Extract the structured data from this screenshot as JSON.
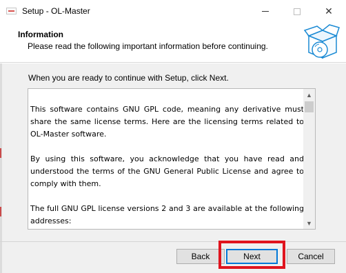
{
  "window": {
    "title": "Setup - OL-Master",
    "controls": {
      "minimize": "",
      "maximize": "",
      "close": "✕"
    }
  },
  "header": {
    "title": "Information",
    "subtitle": "Please read the following important information before continuing."
  },
  "instruction": "When you are ready to continue with Setup, click Next.",
  "license_text": {
    "paragraphs": [
      "This software contains GNU GPL code, meaning any derivative must share the same license terms. Here are the licensing terms related to OL-Master software.",
      "By using this software, you acknowledge that you have read and understood the terms of the GNU General Public License and agree to comply with them.",
      "The full GNU GPL license versions 2 and 3 are available at the following addresses:"
    ]
  },
  "scrollbar": {
    "up": "▲",
    "down": "▼"
  },
  "buttons": {
    "back": "Back",
    "next": "Next",
    "cancel": "Cancel"
  },
  "colors": {
    "highlight": "#e0141e",
    "default_button_border": "#0078d7",
    "icon_blue": "#1a8ad4"
  }
}
